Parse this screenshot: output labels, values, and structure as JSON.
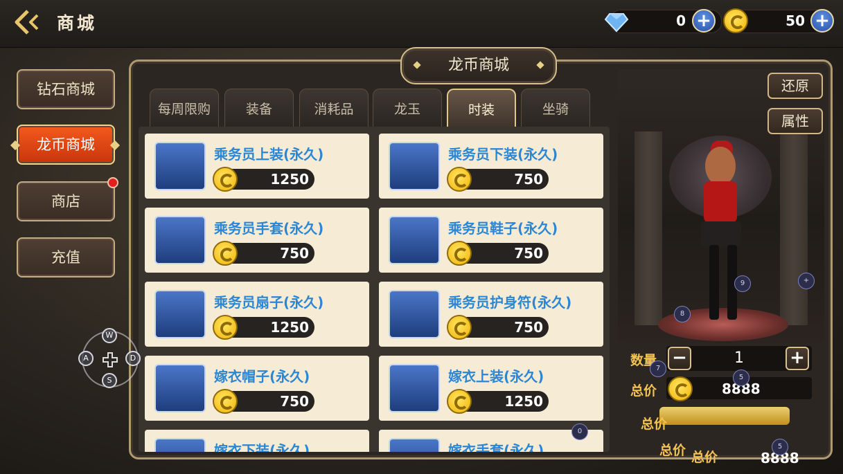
{
  "header": {
    "title": "商城",
    "diamond_amount": "0",
    "coin_amount": "50"
  },
  "sidebar": {
    "items": [
      {
        "label": "钻石商城",
        "active": false
      },
      {
        "label": "龙币商城",
        "active": true
      },
      {
        "label": "商店",
        "active": false,
        "badge": true
      },
      {
        "label": "充值",
        "active": false
      }
    ]
  },
  "panel": {
    "title": "龙币商城",
    "tabs": [
      {
        "label": "每周限购",
        "active": false
      },
      {
        "label": "装备",
        "active": false
      },
      {
        "label": "消耗品",
        "active": false
      },
      {
        "label": "龙玉",
        "active": false
      },
      {
        "label": "时装",
        "active": true
      },
      {
        "label": "坐骑",
        "active": false
      }
    ]
  },
  "items": [
    {
      "name": "乘务员上装(永久)",
      "price": "1250",
      "icon": "outfit-top-icon"
    },
    {
      "name": "乘务员下装(永久)",
      "price": "750",
      "icon": "outfit-bottom-icon"
    },
    {
      "name": "乘务员手套(永久)",
      "price": "750",
      "icon": "glove-icon"
    },
    {
      "name": "乘务员鞋子(永久)",
      "price": "750",
      "icon": "shoes-icon"
    },
    {
      "name": "乘务员扇子(永久)",
      "price": "1250",
      "icon": "fan-icon"
    },
    {
      "name": "乘务员护身符(永久)",
      "price": "750",
      "icon": "amulet-icon"
    },
    {
      "name": "嫁衣帽子(永久)",
      "price": "750",
      "icon": "hat-icon"
    },
    {
      "name": "嫁衣上装(永久)",
      "price": "1250",
      "icon": "wedding-top-icon"
    },
    {
      "name": "嫁衣下装(永久)",
      "price": "",
      "icon": "wedding-bottom-icon"
    },
    {
      "name": "嫁衣手套(永久)",
      "price": "",
      "icon": "wedding-glove-icon"
    }
  ],
  "preview": {
    "restore_label": "还原",
    "attributes_label": "属性"
  },
  "purchase": {
    "quantity_label": "数量",
    "quantity_value": "1",
    "total_label": "总价",
    "total_value": "8888",
    "overlay_total_label_1": "总价",
    "overlay_total_label_2": "总价",
    "overlay_total_label_3": "总价",
    "overlay_total_value": "8888"
  },
  "markers": [
    "0",
    "5",
    "5",
    "7",
    "8",
    "9",
    "+"
  ],
  "joystick": {
    "up": "W",
    "left": "A",
    "right": "D",
    "down": "S"
  },
  "colors": {
    "accent_orange": "#e4471a",
    "item_name_blue": "#2b86d4",
    "gold_label": "#f4c251"
  }
}
